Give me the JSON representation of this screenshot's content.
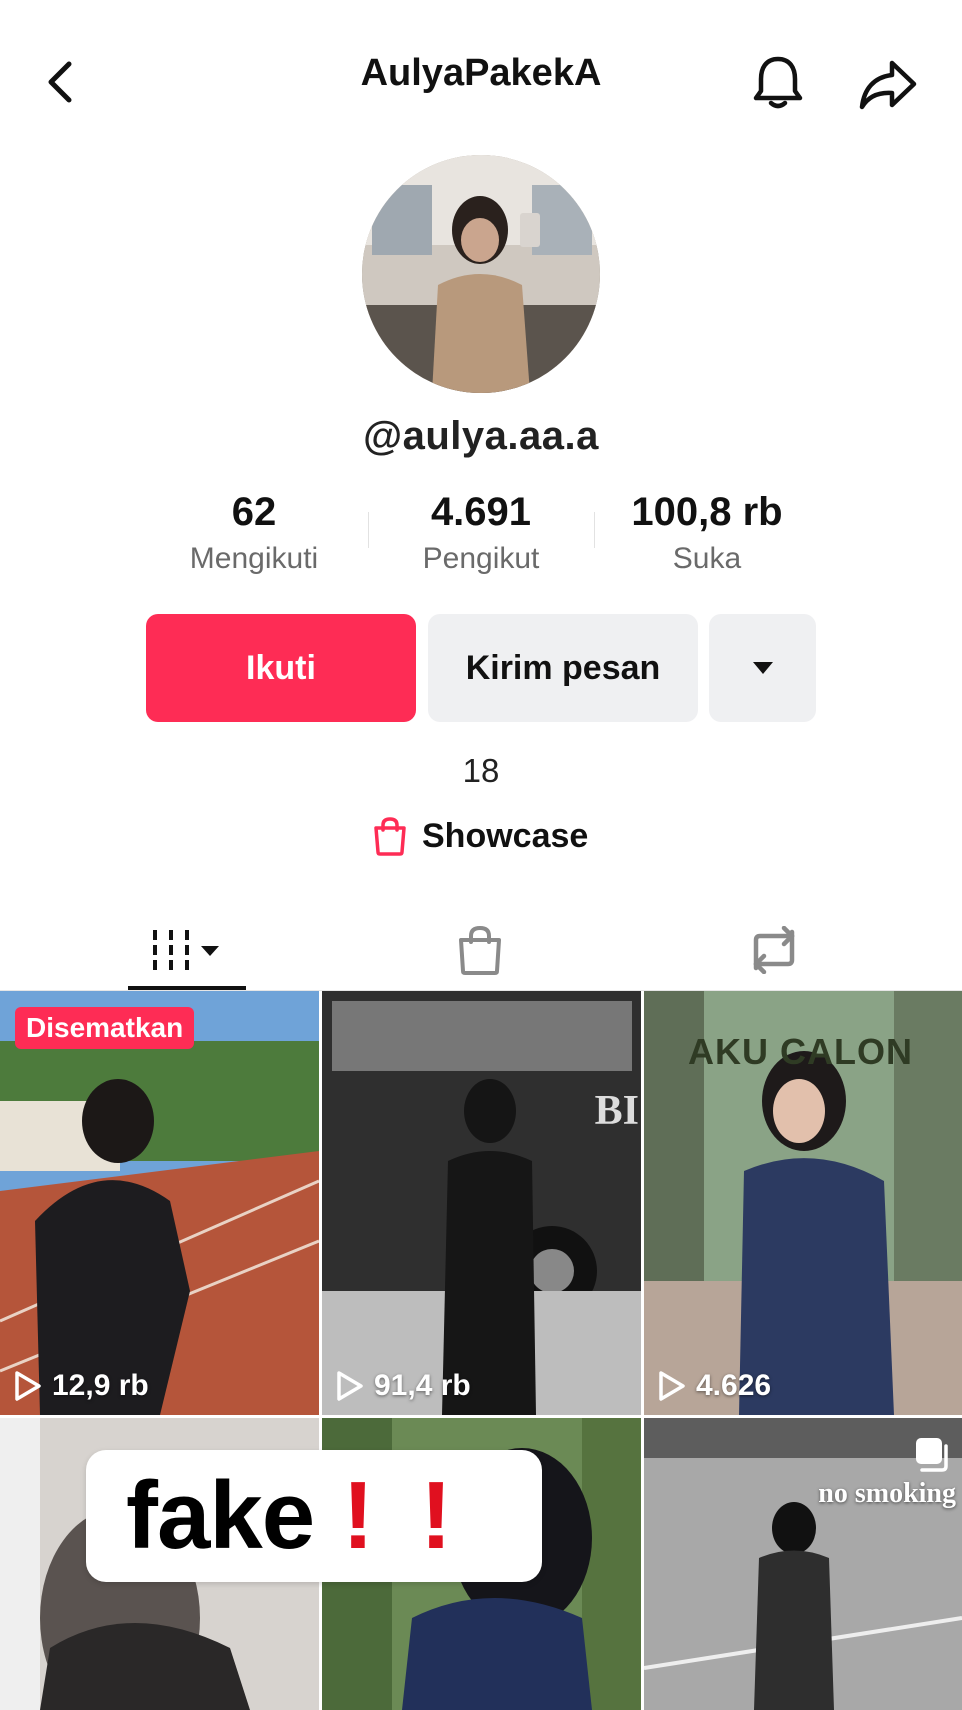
{
  "header": {
    "title": "AulyaPakekA",
    "back_icon": "chevron-left-icon",
    "bell_icon": "bell-icon",
    "share_icon": "share-arrow-icon"
  },
  "profile": {
    "username": "@aulya.aa.a",
    "stats": [
      {
        "value": "62",
        "label": "Mengikuti"
      },
      {
        "value": "4.691",
        "label": "Pengikut"
      },
      {
        "value": "100,8 rb",
        "label": "Suka"
      }
    ],
    "buttons": {
      "follow": "Ikuti",
      "message": "Kirim pesan"
    },
    "bio": "18",
    "showcase": "Showcase"
  },
  "colors": {
    "accent": "#fe2c55",
    "button_bg": "#eff0f2"
  },
  "tabs": [
    {
      "icon": "videos-grid-icon",
      "active": true
    },
    {
      "icon": "shopping-bag-icon",
      "active": false
    },
    {
      "icon": "repost-icon",
      "active": false
    }
  ],
  "videos": [
    {
      "badge": "Disematkan",
      "views": "12,9 rb"
    },
    {
      "views": "91,4 rb",
      "overlay": "BI"
    },
    {
      "views": "4.626",
      "overlay": "AKU CALON"
    },
    {
      "overlay": "fake"
    },
    {},
    {
      "overlay": "no smoking",
      "icon": "multi-photo-icon"
    }
  ]
}
